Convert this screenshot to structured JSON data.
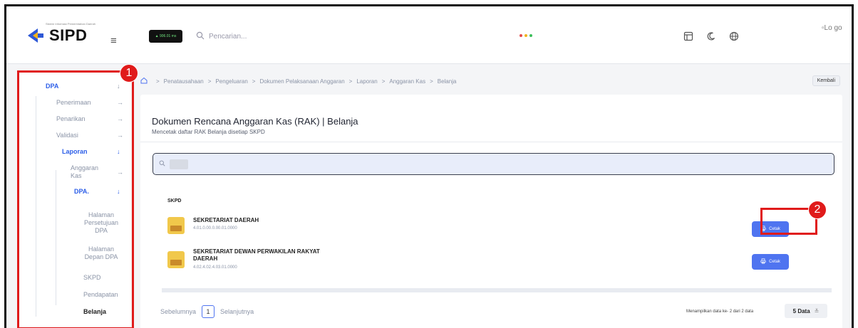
{
  "header": {
    "logo_text": "SIPD",
    "logo_subtext": "Sistem Informasi Pemerintahan Daerah",
    "hamburger_icon": "≡",
    "status_chip": "▲ 906.01 ms",
    "search_placeholder": "Pencarian...",
    "avatar_alt": "Lo go"
  },
  "sidebar": {
    "items": [
      {
        "label": "DPA",
        "arrow": "↓"
      },
      {
        "label": "Penerimaan",
        "arrow": "→"
      },
      {
        "label": "Penarikan",
        "arrow": "→"
      },
      {
        "label": "Validasi",
        "arrow": "→"
      },
      {
        "label": "Laporan",
        "arrow": "↓"
      },
      {
        "label": "Anggaran Kas",
        "arrow": "→"
      },
      {
        "label": "DPA.",
        "arrow": "↓"
      },
      {
        "label": "Halaman Persetujuan DPA"
      },
      {
        "label": "Halaman Depan DPA"
      },
      {
        "label": "SKPD"
      },
      {
        "label": "Pendapatan"
      },
      {
        "label": "Belanja"
      }
    ]
  },
  "annotations": {
    "badge1": "1",
    "badge2": "2"
  },
  "breadcrumb": {
    "items": [
      "Penatausahaan",
      "Pengeluaran",
      "Dokumen Pelaksanaan Anggaran",
      "Laporan",
      "Anggaran Kas",
      "Belanja"
    ],
    "separator": ">",
    "back_label": "Kembali"
  },
  "main": {
    "title": "Dokumen Rencana Anggaran Kas (RAK) | Belanja",
    "subtitle": "Mencetak daftar RAK Belanja disetiap SKPD",
    "column_header": "SKPD",
    "rows": [
      {
        "name": "SEKRETARIAT DAERAH",
        "code": "4.01.0.00.0.00.01.0000",
        "button": "Cetak"
      },
      {
        "name": "SEKRETARIAT DEWAN PERWAKILAN RAKYAT DAERAH",
        "code": "4.02.4.02.4.03.01.0000",
        "button": "Cetak"
      }
    ]
  },
  "pagination": {
    "prev": "Sebelumnya",
    "current": "1",
    "next": "Selanjutnya",
    "info": "Menampilkan data ke- 2 dari 2 data",
    "page_size": "5 Data",
    "page_size_icon": "≚"
  },
  "colors": {
    "accent": "#4f74f0",
    "highlight": "#e01b1b",
    "sidebar_active": "#2c5ee8"
  }
}
